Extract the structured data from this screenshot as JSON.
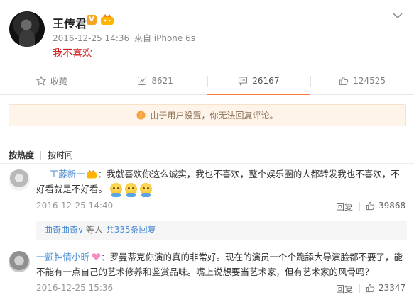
{
  "post": {
    "username": "王传君",
    "verified_badge": "V",
    "time": "2016-12-25 14:36",
    "source": "来自 iPhone 6s",
    "text": "我不喜欢",
    "menu_icon": "chevron-down-icon",
    "accent_text_color": "#d31d1d"
  },
  "actions": {
    "favorite": {
      "label": "收藏",
      "icon": "star-icon"
    },
    "repost": {
      "count": "8621",
      "icon": "repost-icon"
    },
    "comment": {
      "count": "26167",
      "icon": "comment-icon",
      "active": true
    },
    "like": {
      "count": "124525",
      "icon": "thumbs-up-icon"
    }
  },
  "notice": {
    "text": "由于用户设置，你无法回复评论。",
    "icon": "info-icon"
  },
  "sort": {
    "by_hot": "按热度",
    "by_time": "按时间",
    "active": "by_hot"
  },
  "comments": [
    {
      "user": "___工藤新一",
      "text": "：我就喜欢你这么诚实，我也不喜欢，整个娱乐圈的人都转发我也不喜欢，不好看就是不好看。",
      "time": "2016-12-25 14:40",
      "reply_label": "回复",
      "likes": "39868",
      "emojis": [
        "doge-emoji",
        "doge-emoji",
        "doge-emoji"
      ],
      "sub_replies": {
        "user": "曲奇曲奇v",
        "middle": " 等人 ",
        "count_text": "共335条回复"
      }
    },
    {
      "user": "一颤钟情小昕",
      "text": "：罗曼蒂克你演的真的非常好。现在的演员一个个跪舔大导演脸都不要了，能不能有一点自己的艺术修养和鉴赏品味。嘴上说想要当艺术家，但有艺术家的风骨吗？",
      "time": "2016-12-25 15:36",
      "reply_label": "回复",
      "likes": "23347",
      "badge_icon": "heart-icon"
    }
  ]
}
